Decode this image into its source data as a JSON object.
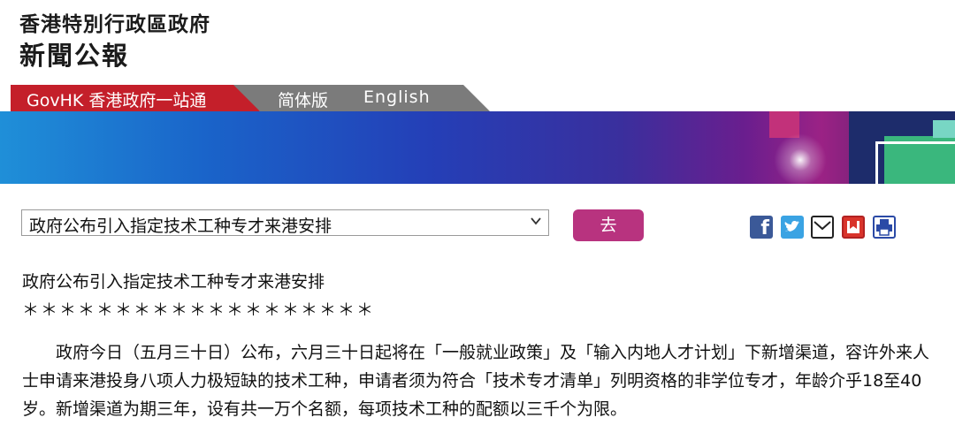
{
  "header": {
    "line1": "香港特別行政區政府",
    "line2": "新聞公報"
  },
  "nav": {
    "govhk": "GovHK 香港政府一站通",
    "simplified": "简体版",
    "english": "English"
  },
  "select": {
    "value": "政府公布引入指定技术工种专才来港安排",
    "go_label": "去"
  },
  "share_icons": [
    "facebook-icon",
    "twitter-icon",
    "email-icon",
    "bookmark-icon",
    "print-icon"
  ],
  "article": {
    "title": "政府公布引入指定技术工种专才来港安排",
    "stars": "＊＊＊＊＊＊＊＊＊＊＊＊＊＊＊＊＊＊＊",
    "paragraph": "政府今日（五月三十日）公布，六月三十日起将在「一般就业政策」及「输入内地人才计划」下新增渠道，容许外来人士申请来港投身八项人力极短缺的技术工种，申请者须为符合「技术专才清单」列明资格的非学位专才，年龄介乎18至40岁。新增渠道为期三年，设有共一万个名额，每项技术工种的配额以三千个为限。"
  },
  "colors": {
    "gov_red": "#c41f2a",
    "nav_grey": "#7b7b7b",
    "go_magenta": "#b8337f"
  }
}
